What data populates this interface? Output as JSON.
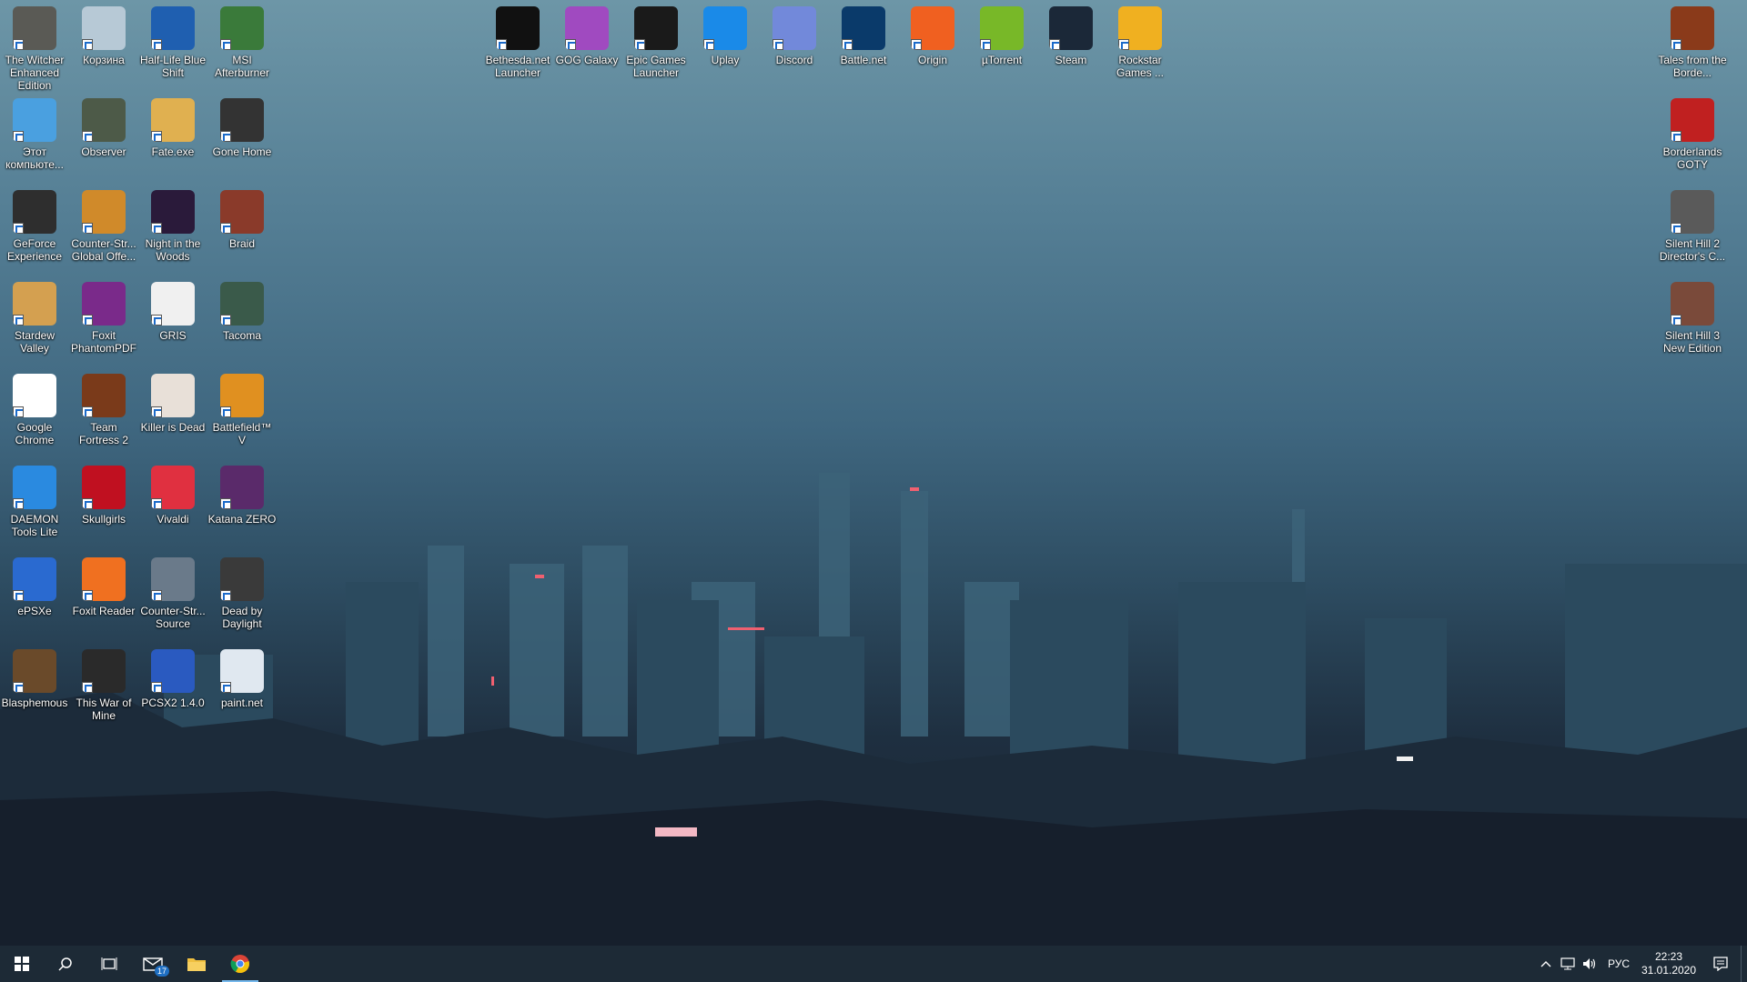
{
  "desktop": {
    "icons_left": [
      {
        "label": "The Witcher Enhanced Edition",
        "icon": "witcher-icon",
        "color": "#5a5a55"
      },
      {
        "label": "Корзина",
        "icon": "recycle-bin-icon",
        "color": "#b7c9d6"
      },
      {
        "label": "Half-Life Blue Shift",
        "icon": "half-life-icon",
        "color": "#1f5fb0"
      },
      {
        "label": "MSI Afterburner",
        "icon": "msi-afterburner-icon",
        "color": "#3a7a3a"
      },
      {
        "label": "Этот компьюте...",
        "icon": "this-pc-icon",
        "color": "#4aa0e0"
      },
      {
        "label": "Observer",
        "icon": "observer-icon",
        "color": "#4d5a48"
      },
      {
        "label": "Fate.exe",
        "icon": "fate-icon",
        "color": "#e0b050"
      },
      {
        "label": "Gone Home",
        "icon": "gone-home-icon",
        "color": "#333333"
      },
      {
        "label": "GeForce Experience",
        "icon": "geforce-icon",
        "color": "#2e2e2e"
      },
      {
        "label": "Counter-Str... Global Offe...",
        "icon": "csgo-icon",
        "color": "#d08a2a"
      },
      {
        "label": "Night in the Woods",
        "icon": "night-in-the-woods-icon",
        "color": "#2a1a3a"
      },
      {
        "label": "Braid",
        "icon": "braid-icon",
        "color": "#8a3a2a"
      },
      {
        "label": "Stardew Valley",
        "icon": "stardew-icon",
        "color": "#d4a050"
      },
      {
        "label": "Foxit PhantomPDF",
        "icon": "foxit-phantom-icon",
        "color": "#7a2a8a"
      },
      {
        "label": "GRIS",
        "icon": "gris-icon",
        "color": "#f0f0f0"
      },
      {
        "label": "Tacoma",
        "icon": "tacoma-icon",
        "color": "#3a5a4a"
      },
      {
        "label": "Google Chrome",
        "icon": "chrome-icon",
        "color": "#ffffff"
      },
      {
        "label": "Team Fortress 2",
        "icon": "tf2-icon",
        "color": "#7a3a1a"
      },
      {
        "label": "Killer is Dead",
        "icon": "killer-is-dead-icon",
        "color": "#e8e0d8"
      },
      {
        "label": "Battlefield™ V",
        "icon": "battlefield-icon",
        "color": "#e09020"
      },
      {
        "label": "DAEMON Tools Lite",
        "icon": "daemon-tools-icon",
        "color": "#2a8ae0"
      },
      {
        "label": "Skullgirls",
        "icon": "skullgirls-icon",
        "color": "#c01020"
      },
      {
        "label": "Vivaldi",
        "icon": "vivaldi-icon",
        "color": "#e03040"
      },
      {
        "label": "Katana ZERO",
        "icon": "katana-zero-icon",
        "color": "#5a2a6a"
      },
      {
        "label": "ePSXe",
        "icon": "epsxe-icon",
        "color": "#2a6ad0"
      },
      {
        "label": "Foxit Reader",
        "icon": "foxit-reader-icon",
        "color": "#f07020"
      },
      {
        "label": "Counter-Str... Source",
        "icon": "cs-source-icon",
        "color": "#6a7a8a"
      },
      {
        "label": "Dead by Daylight",
        "icon": "dead-by-daylight-icon",
        "color": "#3a3a3a"
      },
      {
        "label": "Blasphemous",
        "icon": "blasphemous-icon",
        "color": "#6a4a2a"
      },
      {
        "label": "This War of Mine",
        "icon": "this-war-of-mine-icon",
        "color": "#2a2a2a"
      },
      {
        "label": "PCSX2 1.4.0",
        "icon": "pcsx2-icon",
        "color": "#2a5ac0"
      },
      {
        "label": "paint.net",
        "icon": "paint-net-icon",
        "color": "#e0e8f0"
      }
    ],
    "icons_top": [
      {
        "label": "Bethesda.net Launcher",
        "icon": "bethesda-icon",
        "color": "#111111"
      },
      {
        "label": "GOG Galaxy",
        "icon": "gog-galaxy-icon",
        "color": "#a04ac0"
      },
      {
        "label": "Epic Games Launcher",
        "icon": "epic-games-icon",
        "color": "#1a1a1a"
      },
      {
        "label": "Uplay",
        "icon": "uplay-icon",
        "color": "#1a8ae8"
      },
      {
        "label": "Discord",
        "icon": "discord-icon",
        "color": "#7289da"
      },
      {
        "label": "Battle.net",
        "icon": "battle-net-icon",
        "color": "#0a3a6a"
      },
      {
        "label": "Origin",
        "icon": "origin-icon",
        "color": "#f06020"
      },
      {
        "label": "µTorrent",
        "icon": "utorrent-icon",
        "color": "#78b828"
      },
      {
        "label": "Steam",
        "icon": "steam-icon",
        "color": "#1b2838"
      },
      {
        "label": "Rockstar Games ...",
        "icon": "rockstar-icon",
        "color": "#f0b020"
      }
    ],
    "icons_right": [
      {
        "label": "Tales from the Borde...",
        "icon": "tales-borderlands-icon",
        "color": "#8a3a1a"
      },
      {
        "label": "Borderlands GOTY",
        "icon": "borderlands-icon",
        "color": "#c02020"
      },
      {
        "label": "Silent Hill 2 Director's C...",
        "icon": "silent-hill-2-icon",
        "color": "#5a5a5a"
      },
      {
        "label": "Silent Hill 3 New Edition",
        "icon": "silent-hill-3-icon",
        "color": "#7a4a3a"
      }
    ]
  },
  "taskbar": {
    "mail_badge": "17",
    "language": "РУС",
    "time": "22:23",
    "date": "31.01.2020",
    "accent": "#76b9ed"
  }
}
